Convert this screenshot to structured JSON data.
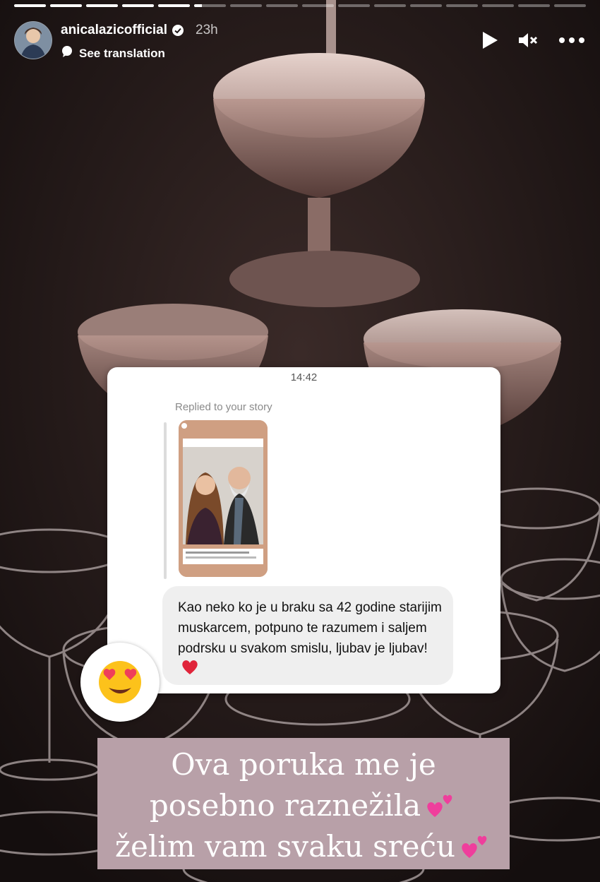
{
  "story": {
    "segments_total": 16,
    "active_segment_index": 5,
    "active_segment_progress": 0.25
  },
  "header": {
    "username": "anicalazicofficial",
    "time_ago": "23h",
    "see_translation": "See translation"
  },
  "controls": {
    "play_icon": "play-icon",
    "mute_icon": "muted-speaker-icon",
    "more_icon": "more-options-icon"
  },
  "message_card": {
    "time": "14:42",
    "replied_label": "Replied to your story",
    "message_text": "Kao neko ko je u braku sa 42 godine starijim muskarcem, potpuno te razumem i saljem podrsku u svakom smislu, ljubav je ljubav!",
    "reaction_emoji": "heart-eyes-emoji"
  },
  "caption": {
    "line1": "Ova poruka me je",
    "line2": "posebno raznežila",
    "line3": "želim vam svaku sreću"
  },
  "colors": {
    "caption_bg": "#b8a0a8",
    "heart_red": "#e0243a",
    "pink_hearts": "#ef3e9c"
  }
}
